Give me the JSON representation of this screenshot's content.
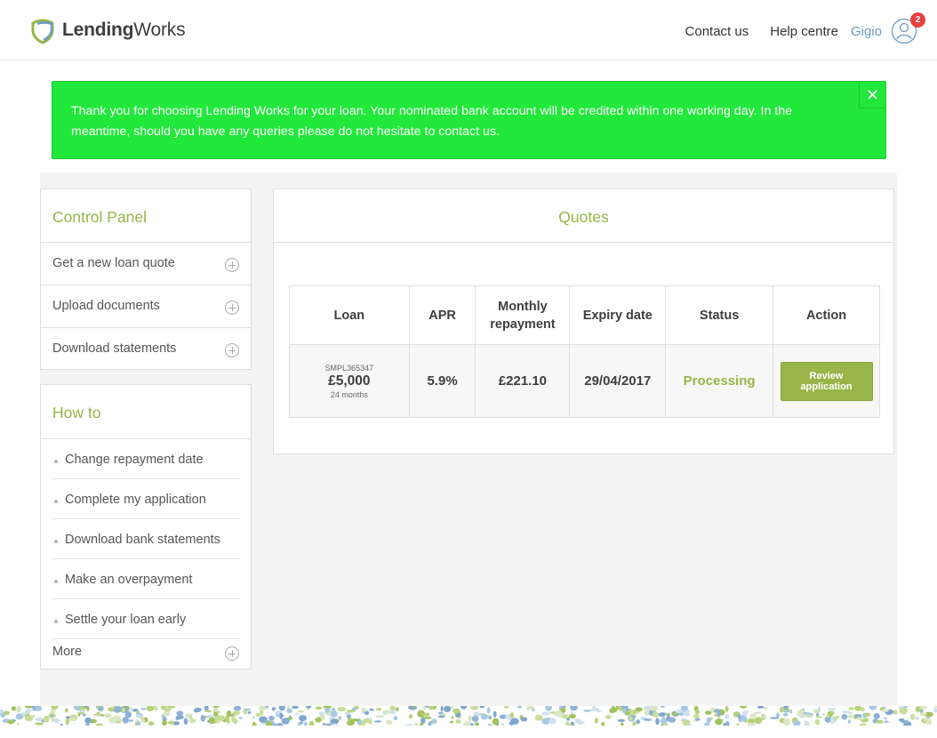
{
  "header": {
    "brand_bold": "Lending",
    "brand_light": "Works",
    "nav": {
      "contact": "Contact us",
      "help": "Help centre",
      "user": "Gigio"
    },
    "notification_count": "2",
    "brand_color": "#96b547",
    "logo_icon": "shield-logo-icon",
    "avatar_icon": "user-icon"
  },
  "alert": {
    "message": "Thank you for choosing Lending Works for your loan. Your nominated bank account will be credited within one working day. In the meantime, should you have any queries please do not hesitate to contact us.",
    "close_glyph": "✕",
    "color": "#21e83a"
  },
  "control_panel": {
    "title": "Control Panel",
    "items": [
      {
        "label": "Get a new loan quote"
      },
      {
        "label": "Upload documents"
      },
      {
        "label": "Download statements"
      }
    ]
  },
  "how_to": {
    "title": "How to",
    "items": [
      {
        "label": "Change repayment date"
      },
      {
        "label": "Complete my application"
      },
      {
        "label": "Download bank statements"
      },
      {
        "label": "Make an overpayment"
      },
      {
        "label": "Settle your loan early"
      }
    ],
    "more": "More"
  },
  "quotes": {
    "title": "Quotes",
    "columns": {
      "loan": "Loan",
      "apr": "APR",
      "monthly_line1": "Monthly",
      "monthly_line2": "repayment",
      "expiry": "Expiry date",
      "status": "Status",
      "action": "Action"
    },
    "rows": [
      {
        "ref": "SMPL365347",
        "amount": "£5,000",
        "term": "24 months",
        "apr": "5.9%",
        "monthly": "£221.10",
        "expiry": "29/04/2017",
        "status": "Processing",
        "action_line1": "Review",
        "action_line2": "application"
      }
    ]
  }
}
